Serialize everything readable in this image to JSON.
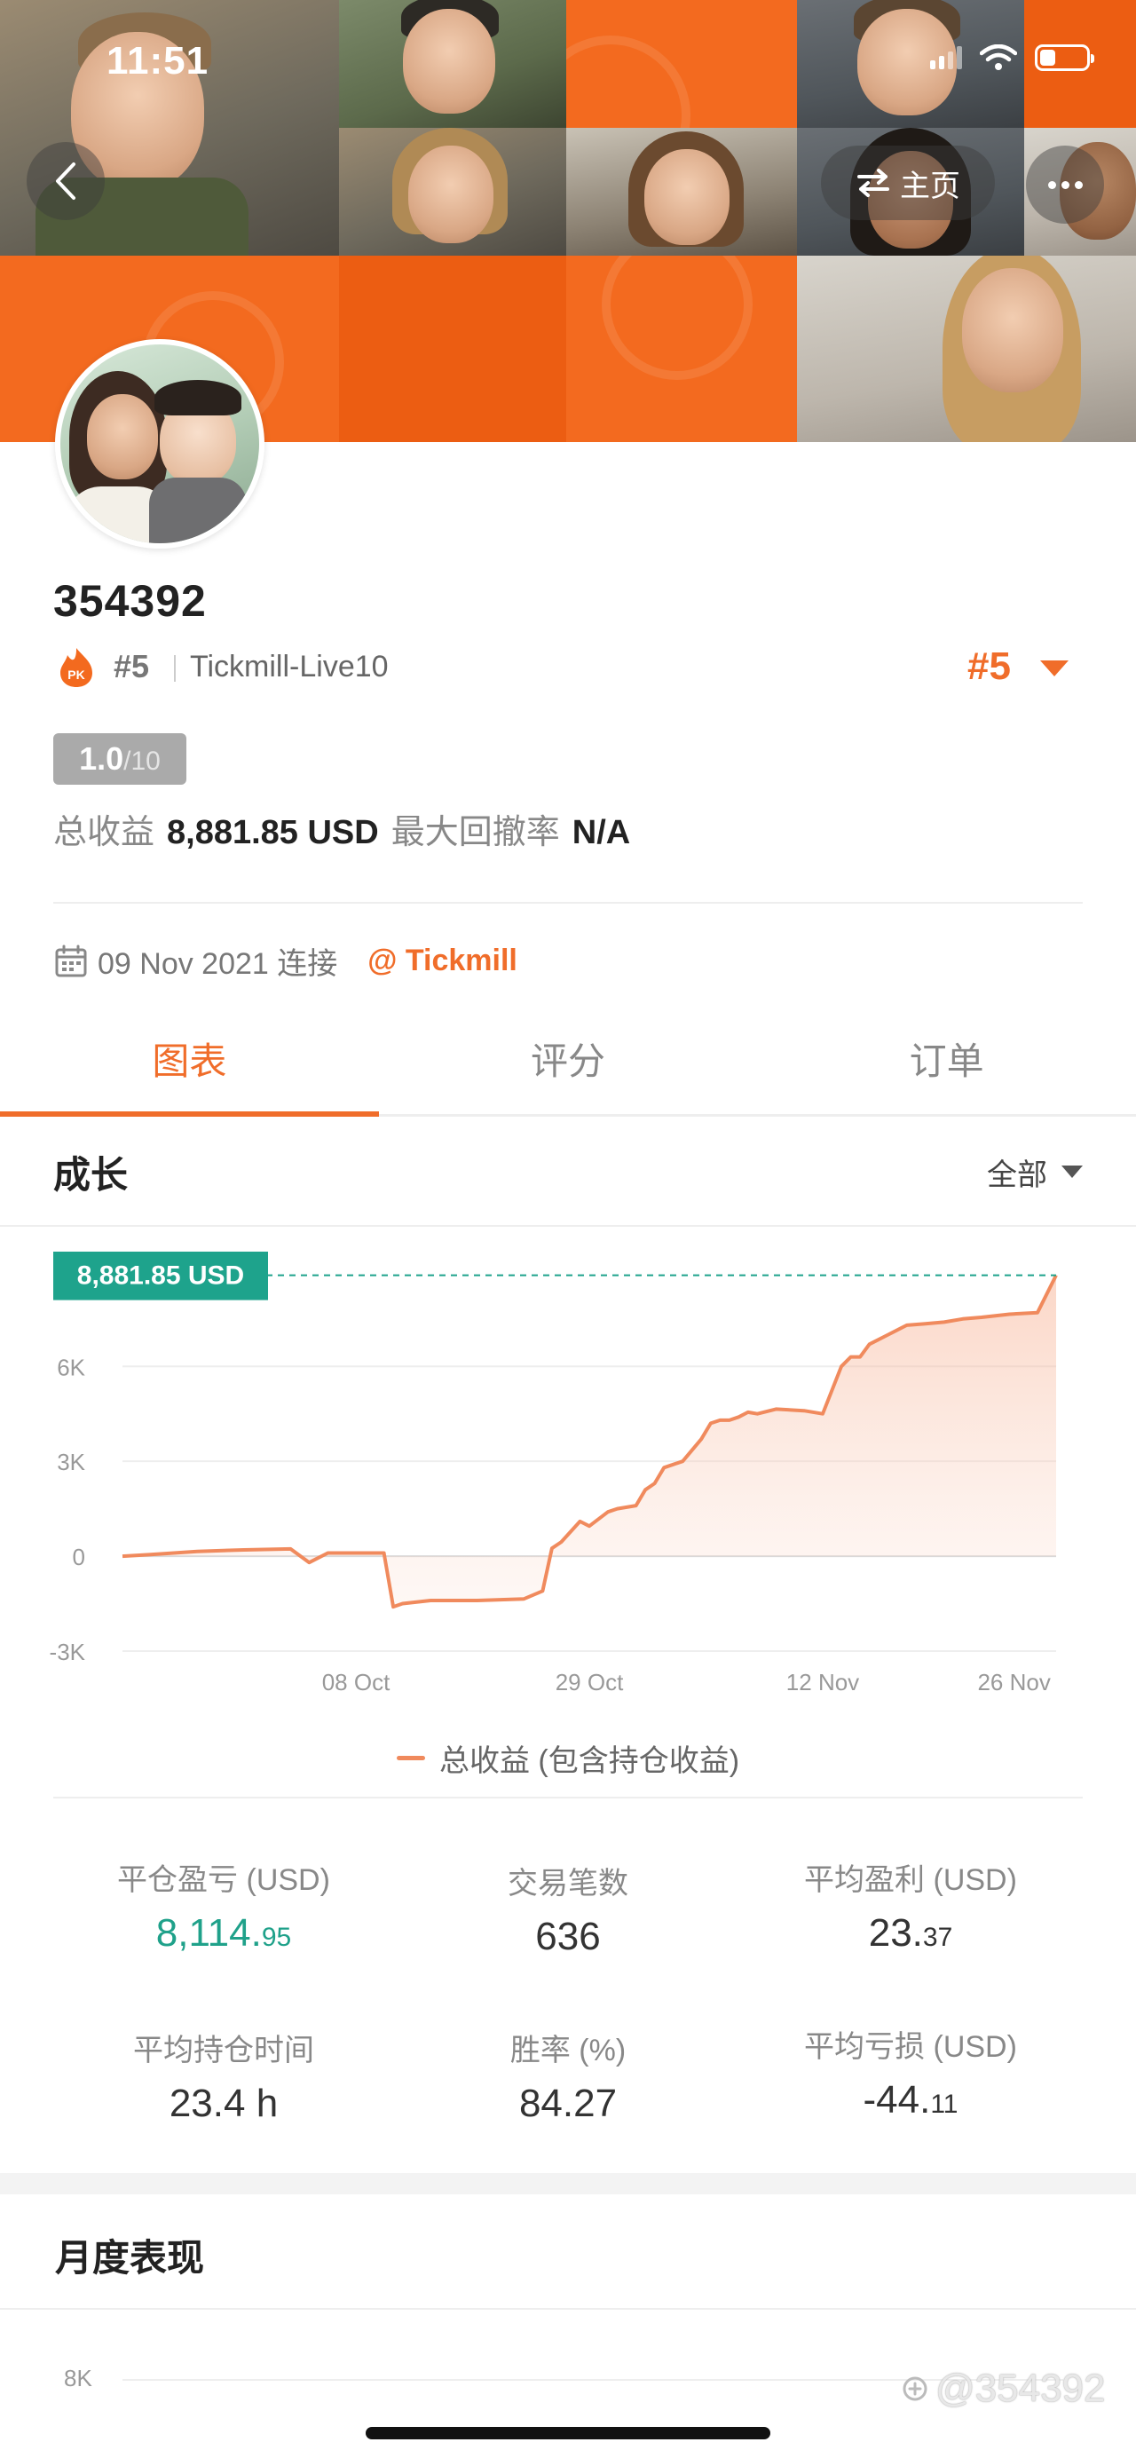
{
  "status_bar": {
    "time": "11:51"
  },
  "header": {
    "home_label": "主页"
  },
  "profile": {
    "username": "354392",
    "rank_small": "#5",
    "broker": "Tickmill-Live10",
    "rank_big": "#5",
    "score_value": "1.0",
    "score_max": "/10",
    "summary": {
      "income_label": "总收益",
      "income_value": "8,881.85 USD",
      "drawdown_label": "最大回撤率",
      "drawdown_value": "N/A"
    },
    "connected_date": "09 Nov 2021 连接",
    "broker_link": "@ Tickmill"
  },
  "tabs": [
    {
      "label": "图表",
      "active": true
    },
    {
      "label": "评分",
      "active": false
    },
    {
      "label": "订单",
      "active": false
    }
  ],
  "growth": {
    "title": "成长",
    "filter_label": "全部"
  },
  "chart_data": {
    "type": "area",
    "title": "",
    "current_value_label": "8,881.85 USD",
    "series": [
      {
        "name": "总收益 (包含持仓收益)",
        "color": "#f08a5d"
      }
    ],
    "x_ticks": [
      "08 Oct",
      "29 Oct",
      "12 Nov",
      "26 Nov"
    ],
    "y_ticks": [
      "6K",
      "3K",
      "0",
      "-3K"
    ],
    "ylim": [
      -3000,
      9000
    ],
    "grid": true,
    "x": [
      0,
      0.03,
      0.08,
      0.13,
      0.18,
      0.2,
      0.22,
      0.25,
      0.28,
      0.29,
      0.3,
      0.33,
      0.38,
      0.43,
      0.45,
      0.46,
      0.47,
      0.49,
      0.5,
      0.52,
      0.53,
      0.55,
      0.56,
      0.57,
      0.58,
      0.6,
      0.62,
      0.63,
      0.64,
      0.65,
      0.66,
      0.67,
      0.68,
      0.7,
      0.73,
      0.75,
      0.77,
      0.78,
      0.79,
      0.8,
      0.82,
      0.84,
      0.86,
      0.88,
      0.9,
      0.92,
      0.95,
      0.98,
      1.0
    ],
    "y": [
      0,
      50,
      150,
      200,
      230,
      -200,
      100,
      100,
      100,
      -1600,
      -1500,
      -1400,
      -1400,
      -1350,
      -1100,
      250,
      450,
      1100,
      950,
      1400,
      1500,
      1600,
      2100,
      2300,
      2800,
      3000,
      3700,
      4200,
      4300,
      4300,
      4400,
      4550,
      4500,
      4650,
      4600,
      4500,
      6000,
      6300,
      6300,
      6700,
      7000,
      7300,
      7350,
      7400,
      7500,
      7550,
      7650,
      7700,
      8881.85
    ]
  },
  "stats": [
    {
      "label": "平仓盈亏 (USD)",
      "value_main": "8,114.",
      "value_dec": "95",
      "green": true
    },
    {
      "label": "交易笔数",
      "value_main": "636",
      "value_dec": "",
      "green": false
    },
    {
      "label": "平均盈利 (USD)",
      "value_main": "23.",
      "value_dec": "37",
      "green": false
    },
    {
      "label": "平均持仓时间",
      "value_main": "23.4 h",
      "value_dec": "",
      "green": false
    },
    {
      "label": "胜率 (%)",
      "value_main": "84.27",
      "value_dec": "",
      "green": false
    },
    {
      "label": "平均亏损 (USD)",
      "value_main": "-44.",
      "value_dec": "11",
      "green": false
    }
  ],
  "monthly": {
    "title": "月度表现",
    "axis_top": "8K"
  },
  "watermark": "@354392"
}
